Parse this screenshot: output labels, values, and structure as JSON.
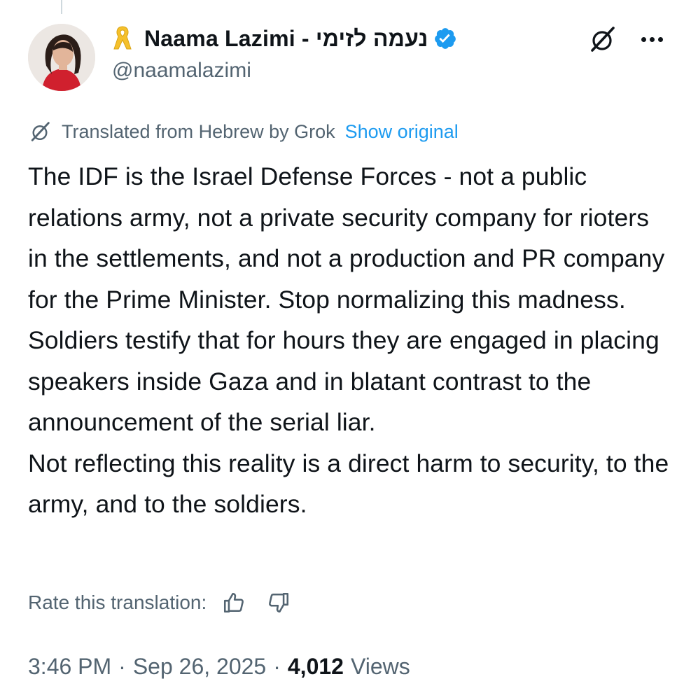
{
  "author": {
    "display_name": "Naama Lazimi - נעמה לזימי",
    "handle": "@naamalazimi",
    "verified_color": "#1d9bf0",
    "ribbon_color": "#f5c02b"
  },
  "translation": {
    "notice": "Translated from Hebrew by Grok",
    "show_original": "Show original",
    "rate_label": "Rate this translation:"
  },
  "tweet": {
    "paragraph_1": "The IDF is the Israel Defense Forces - not a public relations army, not a private security company for rioters in the settlements, and not a production and PR company for the Prime Minister. Stop normalizing this madness.",
    "paragraph_2": "Soldiers testify that for hours they are engaged in placing speakers inside Gaza and in blatant contrast to the announcement of the serial liar.",
    "paragraph_3": "Not reflecting this reality is a direct harm to security, to the army, and to the soldiers."
  },
  "meta": {
    "time": "3:46 PM",
    "separator": "·",
    "date": "Sep 26, 2025",
    "views_count": "4,012",
    "views_label": "Views"
  },
  "icons": {
    "ribbon": "yellow-ribbon-icon",
    "verified": "verified-badge-icon",
    "grok": "grok-icon",
    "more": "more-options-icon",
    "thumbs_up": "thumbs-up-icon",
    "thumbs_down": "thumbs-down-icon"
  }
}
